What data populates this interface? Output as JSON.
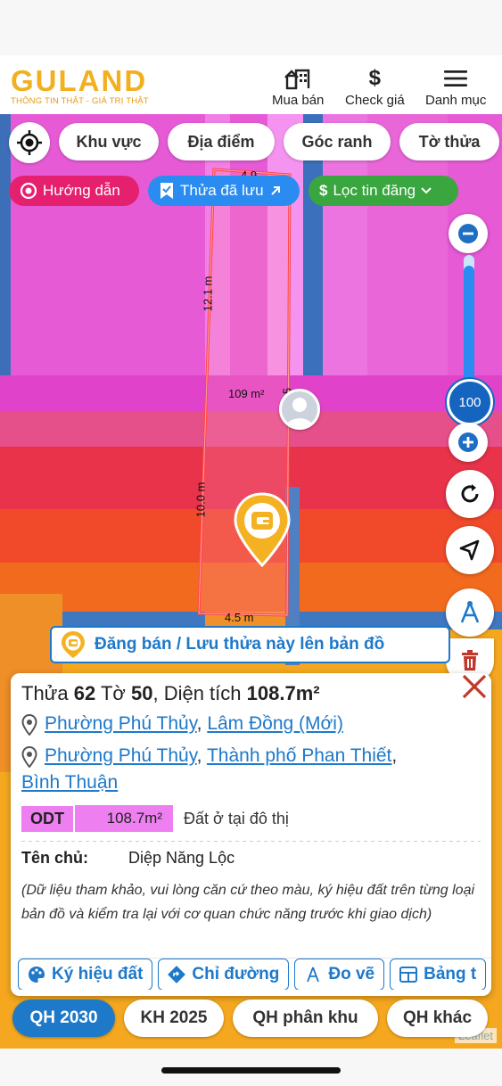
{
  "header": {
    "logo": "GULAND",
    "tagline": "THÔNG TIN THẬT - GIÁ TRỊ THẬT",
    "nav": [
      {
        "label": "Mua bán",
        "icon": "building-icon"
      },
      {
        "label": "Check giá",
        "icon": "dollar-icon"
      },
      {
        "label": "Danh mục",
        "icon": "menu-icon"
      }
    ]
  },
  "filters": {
    "locate_icon": "crosshair-icon",
    "chips": [
      "Khu vực",
      "Địa điểm",
      "Góc ranh",
      "Tờ thửa"
    ]
  },
  "pills": {
    "guide": "Hướng dẫn",
    "saved": "Thửa đã lưu",
    "filter": "Lọc tin đăng"
  },
  "map": {
    "zoom": "100",
    "zoom_fraction": 0.92,
    "plot_labels": {
      "top": "4.9",
      "left_upper": "12.1 m",
      "area": "109 m²",
      "right": "5",
      "left_lower": "10.0 m",
      "bottom": "4.5 m"
    },
    "attribution": "Leaflet"
  },
  "banner": {
    "label": "Đăng bán / Lưu thửa này lên bản đồ"
  },
  "info": {
    "title_prefix": "Thửa",
    "parcel": "62",
    "sheet_prefix": "Tờ",
    "sheet": "50",
    "area_prefix": "Diện tích",
    "area": "108.7m²",
    "loc1_ward": "Phường Phú Thủy",
    "loc1_province": "Lâm Đồng (Mới)",
    "loc2_ward": "Phường Phú Thủy",
    "loc2_city": "Thành phố Phan Thiết",
    "loc2_province": "Bình Thuận",
    "code": "ODT",
    "code_area": "108.7m²",
    "land_type": "Đất ở tại đô thị",
    "owner_label": "Tên chủ:",
    "owner_name": "Diệp Năng Lộc",
    "note": "(Dữ liệu tham khảo, vui lòng căn cứ theo màu, ký hiệu đất trên từng loại bản đồ và kiểm tra lại với cơ quan chức năng trước khi giao dịch)",
    "actions": [
      "Ký hiệu đất",
      "Chỉ đường",
      "Đo vẽ",
      "Bảng t"
    ]
  },
  "tabs": [
    "QH 2030",
    "KH 2025",
    "QH phân khu",
    "QH khác"
  ],
  "colors": {
    "brand": "#f2b01e",
    "accent": "#1e79c9",
    "guide_pill": "#e5206e",
    "saved_pill": "#2a8cf0",
    "filter_pill": "#3aa63f",
    "odt": "#ee7ff0"
  }
}
